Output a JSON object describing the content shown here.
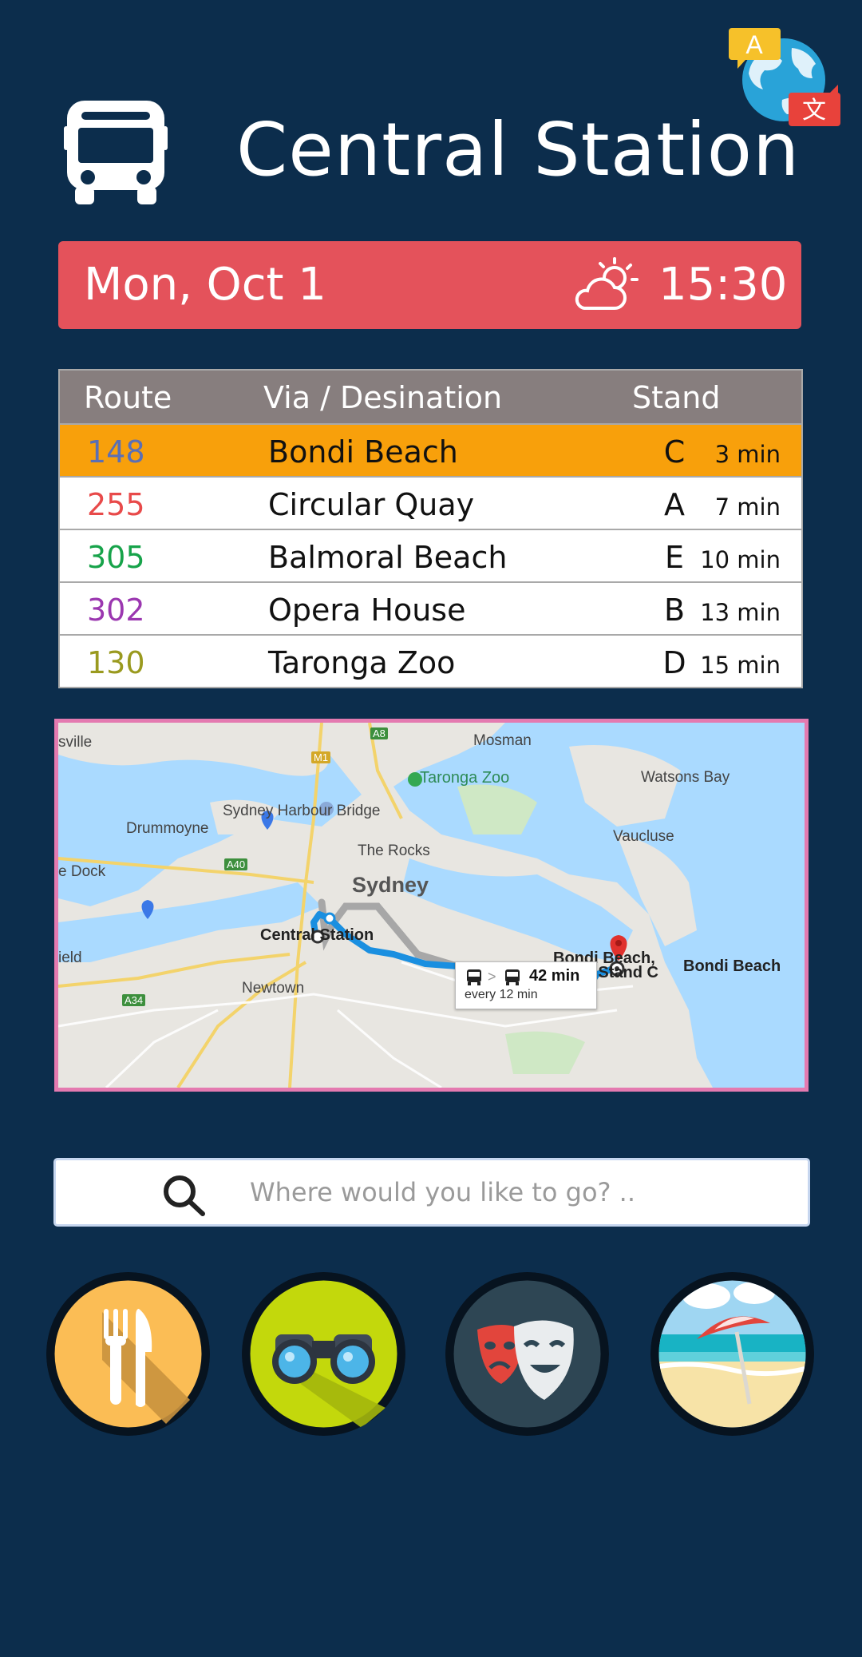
{
  "header": {
    "title": "Central Station",
    "bus_icon": "bus-icon",
    "language_icon": "translate-icon",
    "language_badge_a": "A",
    "language_badge_zh": "文"
  },
  "datebar": {
    "date": "Mon, Oct 1",
    "time": "15:30",
    "weather_icon": "partly-cloudy-icon"
  },
  "table": {
    "headers": {
      "route": "Route",
      "destination": "Via / Desination",
      "stand": "Stand"
    },
    "rows": [
      {
        "route": "148",
        "destination": "Bondi Beach",
        "stand": "C",
        "eta": "3 min",
        "route_color": "#5b6fb5",
        "highlight": true
      },
      {
        "route": "255",
        "destination": "Circular Quay",
        "stand": "A",
        "eta": "7 min",
        "route_color": "#e84a4a"
      },
      {
        "route": "305",
        "destination": "Balmoral Beach",
        "stand": "E",
        "eta": "10 min",
        "route_color": "#17a34a"
      },
      {
        "route": "302",
        "destination": "Opera House",
        "stand": "B",
        "eta": "13 min",
        "route_color": "#9b37b0"
      },
      {
        "route": "130",
        "destination": "Taronga Zoo",
        "stand": "D",
        "eta": "15 min",
        "route_color": "#9a9a1f"
      }
    ],
    "highlight_color": "#f8a00b"
  },
  "map": {
    "labels": {
      "sville": "sville",
      "mosman": "Mosman",
      "a8": "A8",
      "m1": "M1",
      "taronga": "Taronga Zoo",
      "watsons": "Watsons Bay",
      "harbour_bridge": "Sydney Harbour Bridge",
      "drummoyne": "Drummoyne",
      "vaucluse": "Vaucluse",
      "a40": "A40",
      "rocks": "The Rocks",
      "dock": "e Dock",
      "sydney": "Sydney",
      "central": "Central Station",
      "ield": "ield",
      "newtown": "Newtown",
      "a34": "A34",
      "bondi_stop": "Bondi Beach,",
      "campbell": "Campbell Pde, Stand C",
      "bondi": "Bondi Beach"
    },
    "route_card": {
      "duration": "42 min",
      "frequency": "every 12 min",
      "separator": ">"
    }
  },
  "search": {
    "placeholder": "Where would you like to go? .."
  },
  "categories": [
    {
      "name": "food",
      "icon": "fork-knife-icon",
      "bg": "#fbbd55"
    },
    {
      "name": "sightseeing",
      "icon": "binoculars-icon",
      "bg": "#c3d80c"
    },
    {
      "name": "theatre",
      "icon": "theatre-masks-icon",
      "bg": "#2e4654"
    },
    {
      "name": "beach",
      "icon": "beach-umbrella-icon",
      "bg": "#9fd6f2"
    }
  ]
}
